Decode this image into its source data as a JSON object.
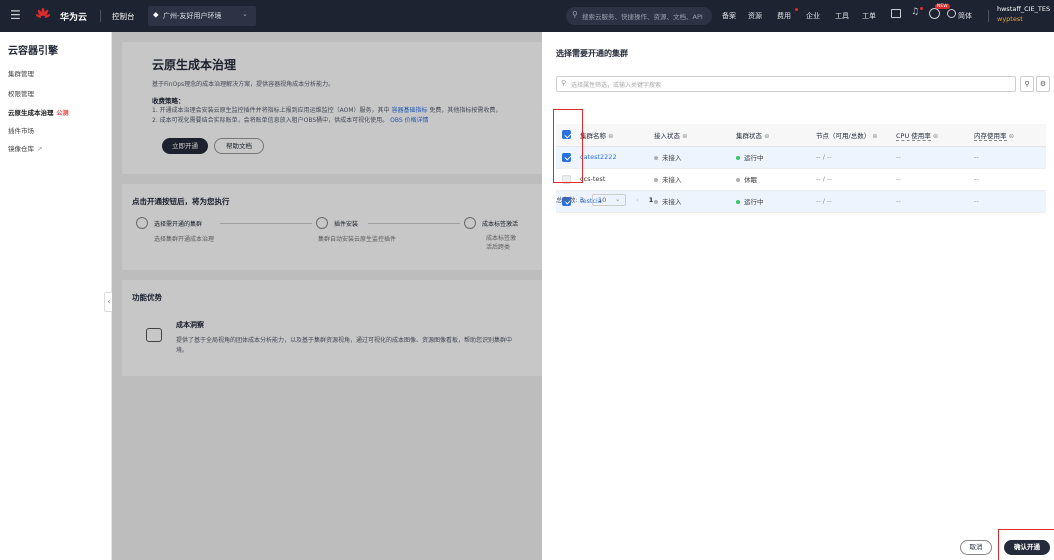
{
  "topbar": {
    "brand": "华为云",
    "console": "控制台",
    "region": "广州-友好用户环境",
    "search_placeholder": "搜索云服务、快捷操作、资源、文档、API",
    "nav": [
      "备案",
      "资源",
      "费用",
      "企业",
      "工具",
      "工单"
    ],
    "new_badge": "NEW",
    "lang": "简体",
    "user_line1": "hwstaff_CIE_TES",
    "user_line2": "wyptest"
  },
  "sidebar": {
    "title": "云容器引擎",
    "items": [
      {
        "label": "集群管理"
      },
      {
        "label": "权限管理"
      },
      {
        "label": "云原生成本治理",
        "badge": "公测"
      },
      {
        "label": "插件市场"
      },
      {
        "label": "镜像仓库"
      }
    ]
  },
  "main": {
    "title": "云原生成本治理",
    "subtitle": "基于FinOps理念的成本治理解决方案，提供容器视角成本分析能力。",
    "fee_title": "收费策略：",
    "fee_line1": "1. 开通成本治理会安装云原生监控插件并将指标上报到应用运维监控（AOM）服务，其中",
    "fee_line1_link": "容器基础指标",
    "fee_line1_tail": "免费，其他指标按需收费，",
    "fee_line2": "2. 成本可视化需要结合实际账单，会将账单信息放入租户OBS桶中，供成本可视化使用。",
    "fee_line2_link": "OBS 价格详情",
    "open_btn": "立即开通",
    "help_btn": "帮助文档",
    "steps_title": "点击开通按钮后，将为您执行",
    "steps": [
      {
        "label": "选择需开通的集群",
        "desc": "选择集群开通成本治理"
      },
      {
        "label": "插件安装",
        "desc": "集群自动安装云原生监控插件"
      },
      {
        "label": "成本标签激活",
        "desc": "成本标签激活后跨类"
      }
    ],
    "adv_title": "功能优势",
    "adv_name": "成本洞察",
    "adv_desc1": "提供了基于全局视角的团体成本分析能力，以及基于集群资源视角，通过可视化的成本图像、资源图像看板，帮助您识别集群中",
    "adv_desc2": "境。"
  },
  "panel": {
    "title": "选择需要开通的集群",
    "search_placeholder": "选择属性筛选，或输入关键字搜索",
    "columns": [
      "集群名称",
      "接入状态",
      "集群状态",
      "节点（可用/总数）",
      "CPU 使用率",
      "内存使用率"
    ],
    "rows": [
      {
        "name": "catest2222",
        "access": "未接入",
        "status": "运行中",
        "nodes": "-- / --",
        "cpu": "--",
        "mem": "--",
        "checked": true
      },
      {
        "name": "ccs-test",
        "access": "未接入",
        "status": "休眠",
        "nodes": "-- / --",
        "cpu": "--",
        "mem": "--",
        "checked": false
      },
      {
        "name": "testcia",
        "access": "未接入",
        "status": "运行中",
        "nodes": "-- / --",
        "cpu": "--",
        "mem": "--",
        "checked": true
      }
    ],
    "total_label": "总条数: 3",
    "page_size": "10",
    "page": "1",
    "cancel": "取消",
    "confirm": "确认开通"
  },
  "colors": {
    "topbar": "#1e2331",
    "accent": "#2970e0",
    "running": "#3ac562",
    "inactive": "#b0b0b0",
    "danger": "#e02c2c"
  }
}
